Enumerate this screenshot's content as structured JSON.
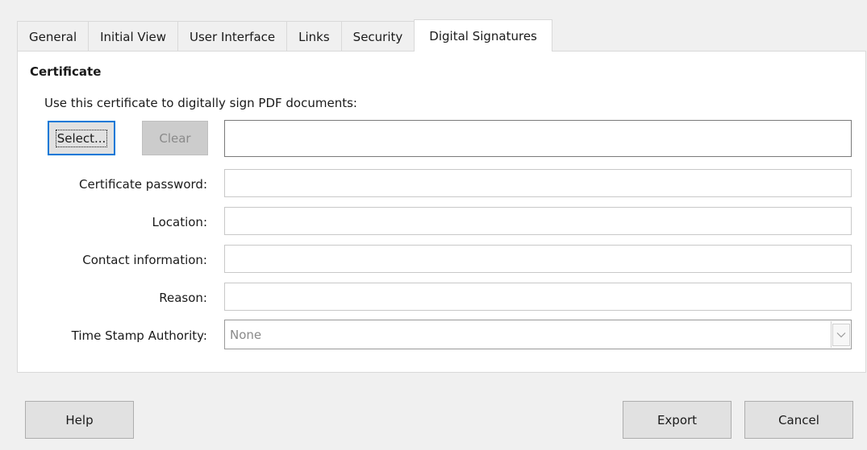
{
  "tabs": [
    "General",
    "Initial View",
    "User Interface",
    "Links",
    "Security",
    "Digital Signatures"
  ],
  "active_tab": "Digital Signatures",
  "certificate": {
    "section_title": "Certificate",
    "description": "Use this certificate to digitally sign PDF documents:",
    "select_label": "Select...",
    "clear_label": "Clear",
    "certificate_value": ""
  },
  "fields": {
    "password_label": "Certificate password:",
    "password_value": "",
    "location_label": "Location:",
    "location_value": "",
    "contact_label": "Contact information:",
    "contact_value": "",
    "reason_label": "Reason:",
    "reason_value": "",
    "tsa_label": "Time Stamp Authority:",
    "tsa_value": "None"
  },
  "footer": {
    "help_label": "Help",
    "export_label": "Export",
    "cancel_label": "Cancel"
  },
  "colors": {
    "accent": "#0078d7",
    "panel_bg": "#ffffff",
    "dialog_bg": "#f0f0f0"
  },
  "icons": {
    "dropdown": "chevron-down-icon"
  }
}
